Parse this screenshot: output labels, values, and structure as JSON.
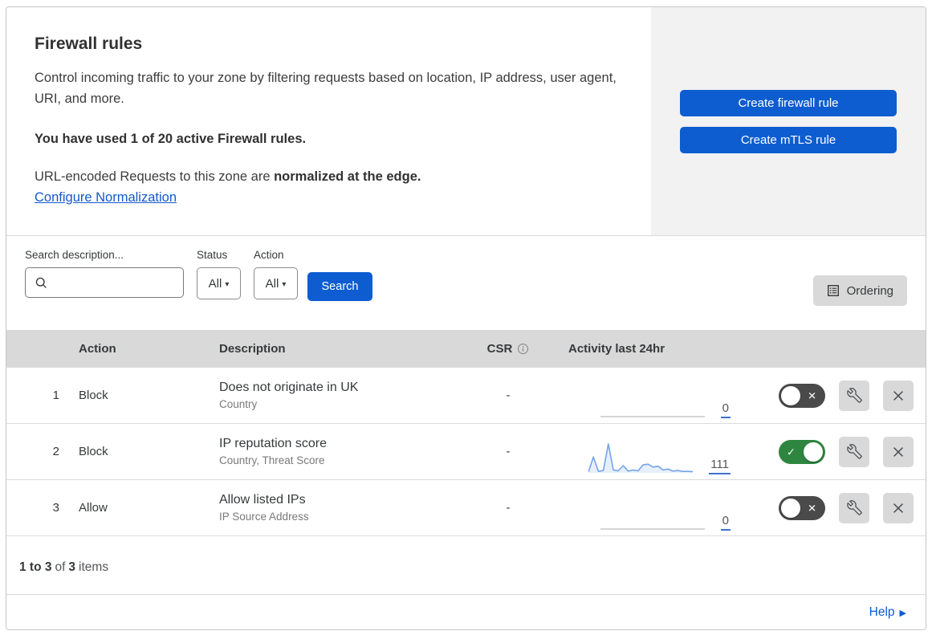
{
  "header": {
    "title": "Firewall rules",
    "description": "Control incoming traffic to your zone by filtering requests based on location, IP address, user agent, URI, and more.",
    "usage": "You have used 1 of 20 active Firewall rules.",
    "normalization_prefix": "URL-encoded Requests to this zone are ",
    "normalization_bold": "normalized at the edge.",
    "normalization_link": "Configure Normalization",
    "buttons": {
      "create_firewall": "Create firewall rule",
      "create_mtls": "Create mTLS rule"
    }
  },
  "filters": {
    "search_label": "Search description...",
    "status_label": "Status",
    "status_value": "All",
    "action_label": "Action",
    "action_value": "All",
    "search_button": "Search",
    "ordering_button": "Ordering"
  },
  "table": {
    "columns": {
      "action": "Action",
      "description": "Description",
      "csr": "CSR",
      "activity": "Activity last 24hr"
    },
    "rows": [
      {
        "priority": "1",
        "action": "Block",
        "description": "Does not originate in UK",
        "fields": "Country",
        "csr": "-",
        "activity_count": "0",
        "enabled": false,
        "sparkline": [
          0,
          0
        ]
      },
      {
        "priority": "2",
        "action": "Block",
        "description": "IP reputation score",
        "fields": "Country, Threat Score",
        "csr": "-",
        "activity_count": "111",
        "enabled": true,
        "sparkline": [
          3,
          55,
          5,
          8,
          100,
          10,
          7,
          25,
          6,
          10,
          7,
          28,
          30,
          20,
          23,
          10,
          13,
          6,
          8,
          5,
          5,
          4
        ]
      },
      {
        "priority": "3",
        "action": "Allow",
        "description": "Allow listed IPs",
        "fields": "IP Source Address",
        "csr": "-",
        "activity_count": "0",
        "enabled": false,
        "sparkline": [
          0,
          0
        ]
      }
    ]
  },
  "footer": {
    "range": "1 to 3",
    "of": "of",
    "total": "3",
    "items": "items",
    "help": "Help"
  },
  "colors": {
    "accent_blue": "#0d5dd1",
    "link_blue": "#1459cb",
    "toggle_on_green": "#2e8540",
    "toggle_off_gray": "#4a4a4a",
    "sparkline_blue": "#74a4e8",
    "panel_gray": "#f2f2f2",
    "header_gray": "#d9d9d9"
  }
}
